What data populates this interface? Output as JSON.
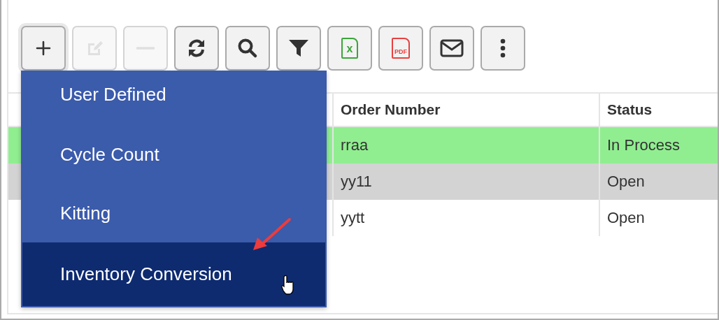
{
  "toolbar": [
    {
      "kind": "add",
      "disabled": false,
      "active": true
    },
    {
      "kind": "edit",
      "disabled": true,
      "active": false
    },
    {
      "kind": "remove",
      "disabled": true,
      "active": false
    },
    {
      "kind": "refresh",
      "disabled": false,
      "active": false
    },
    {
      "kind": "search",
      "disabled": false,
      "active": false
    },
    {
      "kind": "filter",
      "disabled": false,
      "active": false
    },
    {
      "kind": "excel",
      "glyph": "x",
      "disabled": false,
      "active": false
    },
    {
      "kind": "pdf",
      "glyph": "PDF",
      "disabled": false,
      "active": false
    },
    {
      "kind": "email",
      "disabled": false,
      "active": false
    },
    {
      "kind": "more",
      "disabled": false,
      "active": false
    }
  ],
  "table": {
    "columns": [
      "Order Number",
      "Status"
    ],
    "rows": [
      {
        "color": "#90ee90",
        "cells": [
          "rraa",
          "In Process"
        ]
      },
      {
        "color": "#d3d3d3",
        "cells": [
          "yy11",
          "Open"
        ]
      },
      {
        "color": "#ffffff",
        "cells": [
          "yytt",
          "Open"
        ]
      }
    ]
  },
  "menu": {
    "items": [
      {
        "label": "User Defined",
        "selected": false
      },
      {
        "label": "Cycle Count",
        "selected": false
      },
      {
        "label": "Kitting",
        "selected": false
      },
      {
        "label": "Inventory Conversion",
        "selected": true
      }
    ]
  }
}
